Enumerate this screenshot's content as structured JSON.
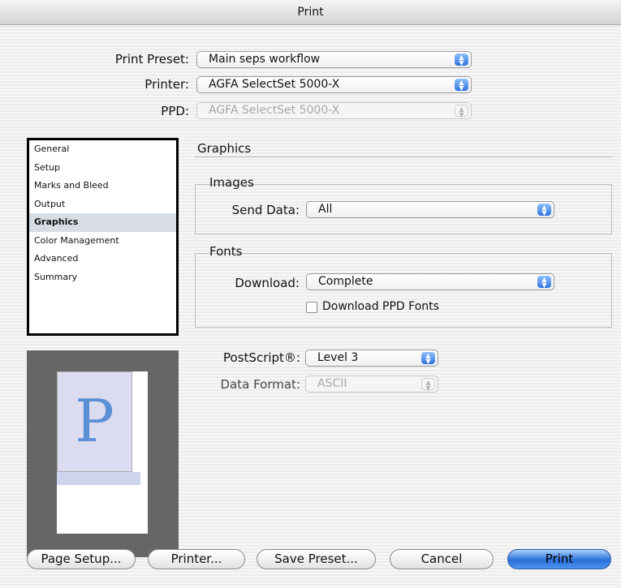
{
  "window": {
    "title": "Print"
  },
  "presets": {
    "print_preset_label": "Print Preset:",
    "print_preset_value": "Main seps workflow",
    "printer_label": "Printer:",
    "printer_value": "AGFA SelectSet 5000-X",
    "ppd_label": "PPD:",
    "ppd_value": "AGFA SelectSet 5000-X"
  },
  "sidebar": {
    "items": [
      {
        "label": "General"
      },
      {
        "label": "Setup"
      },
      {
        "label": "Marks and Bleed"
      },
      {
        "label": "Output"
      },
      {
        "label": "Graphics"
      },
      {
        "label": "Color Management"
      },
      {
        "label": "Advanced"
      },
      {
        "label": "Summary"
      }
    ],
    "selected": "Graphics"
  },
  "preview": {
    "letter": "P"
  },
  "panel": {
    "title": "Graphics",
    "images": {
      "title": "Images",
      "send_data_label": "Send Data:",
      "send_data_value": "All"
    },
    "fonts": {
      "title": "Fonts",
      "download_label": "Download:",
      "download_value": "Complete",
      "download_ppd_label": "Download PPD Fonts",
      "download_ppd_checked": false
    },
    "postscript_label": "PostScript®:",
    "postscript_value": "Level 3",
    "data_format_label": "Data Format:",
    "data_format_value": "ASCII"
  },
  "buttons": {
    "page_setup": "Page Setup...",
    "printer": "Printer...",
    "save_preset": "Save Preset...",
    "cancel": "Cancel",
    "print": "Print"
  },
  "colors": {
    "accent": "#2f74de",
    "selected_row": "#d8dde3"
  }
}
